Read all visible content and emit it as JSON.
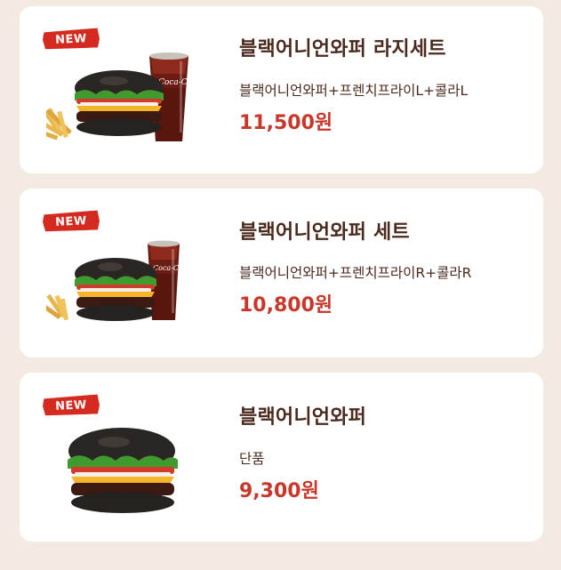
{
  "menu": {
    "items": [
      {
        "badge": "NEW",
        "name": "블랙어니언와퍼 라지세트",
        "description": "블랙어니언와퍼+프렌치프라이L+콜라L",
        "price": "11,500원",
        "image_icon": "burger-fries-cola-large"
      },
      {
        "badge": "NEW",
        "name": "블랙어니언와퍼 세트",
        "description": "블랙어니언와퍼+프렌치프라이R+콜라R",
        "price": "10,800원",
        "image_icon": "burger-fries-cola-regular"
      },
      {
        "badge": "NEW",
        "name": "블랙어니언와퍼",
        "description": "단품",
        "price": "9,300원",
        "image_icon": "burger-single"
      }
    ]
  },
  "colors": {
    "background": "#f3ebe2",
    "card": "#ffffff",
    "badge": "#d52a1f",
    "title": "#4b2a1e",
    "price": "#c8372a"
  },
  "image_text": {
    "cola_logo": "Coca-Cola"
  }
}
